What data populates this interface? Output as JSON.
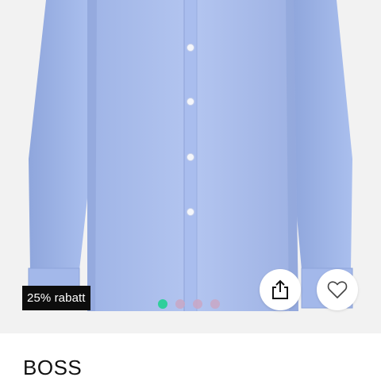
{
  "product": {
    "brand": "BOSS",
    "discount_badge": "25% rabatt",
    "image_icon": "shirt-photo",
    "colors": {
      "shirt": "#a9bde8",
      "badge_bg": "#0d0d0d",
      "active_dot": "#2fcf9b",
      "inactive_dot": "#c9a7c4"
    }
  },
  "gallery": {
    "page_count": 4,
    "active_index": 0
  },
  "actions": {
    "share_icon": "share-icon",
    "wishlist_icon": "heart-icon"
  }
}
